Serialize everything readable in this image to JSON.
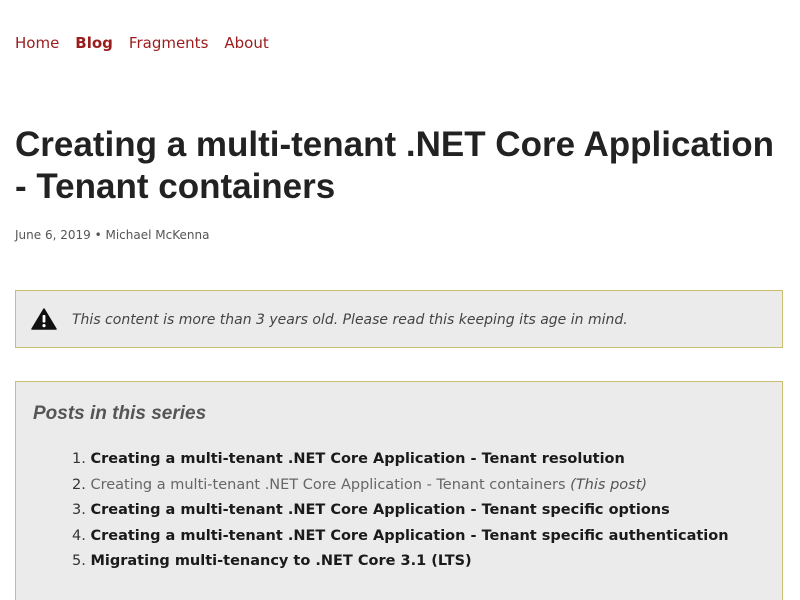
{
  "nav": {
    "items": [
      {
        "label": "Home",
        "active": false
      },
      {
        "label": "Blog",
        "active": true
      },
      {
        "label": "Fragments",
        "active": false
      },
      {
        "label": "About",
        "active": false
      }
    ]
  },
  "post": {
    "title": "Creating a multi-tenant .NET Core Application - Tenant containers",
    "date": "June 6, 2019",
    "separator": "•",
    "author": "Michael McKenna"
  },
  "notice": {
    "icon": "warning-triangle-icon",
    "text": "This content is more than 3 years old. Please read this keeping its age in mind."
  },
  "series": {
    "heading": "Posts in this series",
    "items": [
      {
        "number": "1.",
        "label": "Creating a multi-tenant .NET Core Application - Tenant resolution"
      },
      {
        "number": "2.",
        "label": "Creating a multi-tenant .NET Core Application - Tenant containers",
        "note": "(This post)"
      },
      {
        "number": "3.",
        "label": "Creating a multi-tenant .NET Core Application - Tenant specific options"
      },
      {
        "number": "4.",
        "label": "Creating a multi-tenant .NET Core Application - Tenant specific authentication"
      },
      {
        "number": "5.",
        "label": "Migrating multi-tenancy to .NET Core 3.1 (LTS)"
      }
    ]
  },
  "colors": {
    "link": "#9b1c1c",
    "panel_background": "#ebebeb",
    "panel_border": "#c8c070"
  }
}
